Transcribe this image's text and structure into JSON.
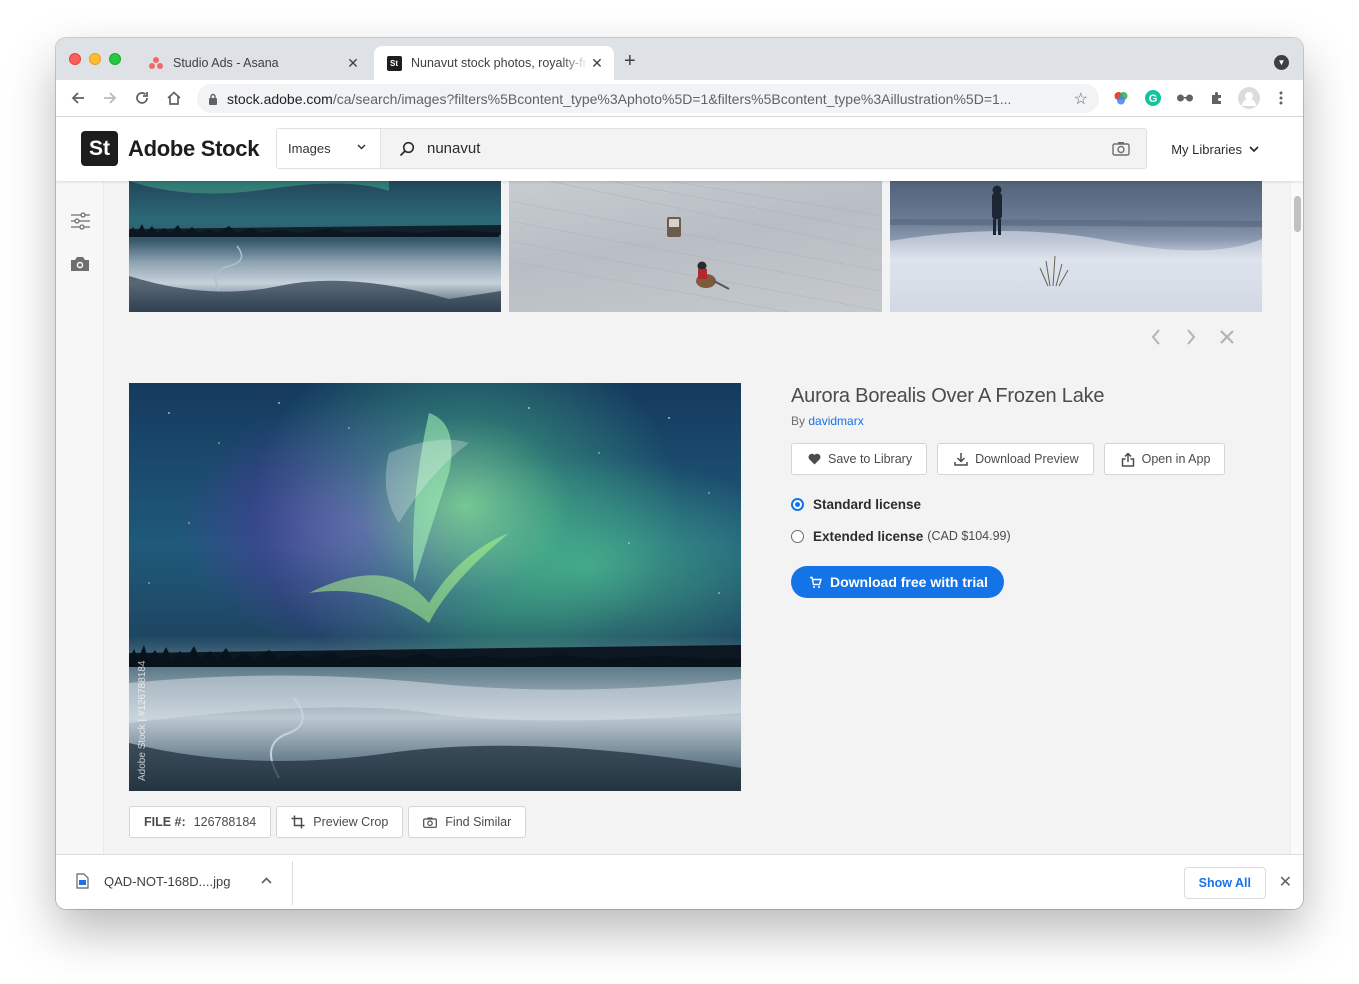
{
  "browser": {
    "tabs": [
      {
        "title": "Studio Ads - Asana",
        "favicon": "asana-icon",
        "active": false
      },
      {
        "title": "Nunavut stock photos, royalty-free images",
        "favicon": "adobe-stock-icon",
        "active": true
      }
    ],
    "url_host": "stock.adobe.com",
    "url_path": "/ca/search/images?filters%5Bcontent_type%3Aphoto%5D=1&filters%5Bcontent_type%3Aillustration%5D=1..."
  },
  "header": {
    "logo_text": "St",
    "brand": "Adobe Stock",
    "scope": "Images",
    "query": "nunavut",
    "my_libraries": "My Libraries"
  },
  "detail": {
    "title": "Aurora Borealis Over A Frozen Lake",
    "by_prefix": "By",
    "author": "davidmarx",
    "actions": {
      "save": "Save to Library",
      "download_preview": "Download Preview",
      "open_in_app": "Open in App"
    },
    "licenses": {
      "standard": "Standard license",
      "extended": "Extended license",
      "extended_price": "(CAD $104.99)"
    },
    "cta": "Download free with trial",
    "watermark": "Adobe Stock | #126788184"
  },
  "filebar": {
    "file_label": "FILE #:",
    "file_number": "126788184",
    "preview_crop": "Preview Crop",
    "find_similar": "Find Similar"
  },
  "downloads": {
    "filename": "QAD-NOT-168D....jpg",
    "show_all": "Show All"
  },
  "colors": {
    "accent": "#1473e6",
    "chrome_tabstrip": "#dee1e6"
  }
}
